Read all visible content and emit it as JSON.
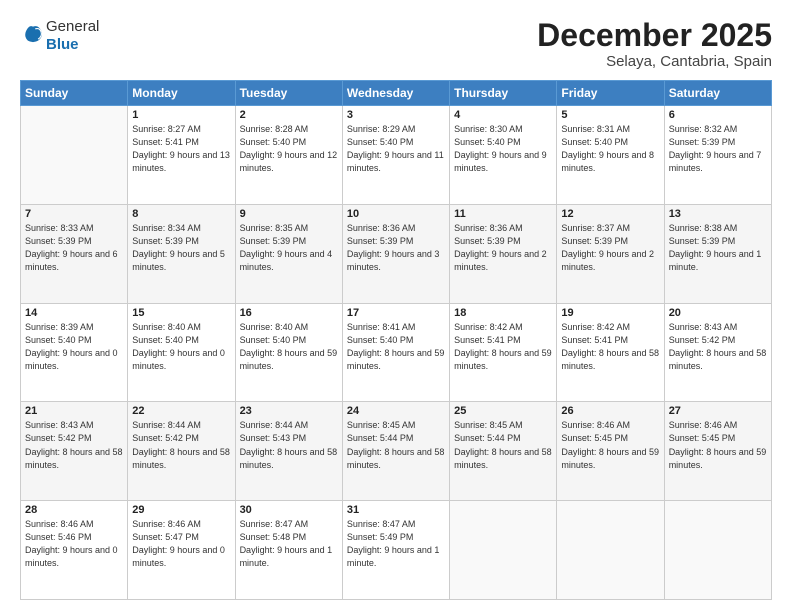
{
  "logo": {
    "general": "General",
    "blue": "Blue"
  },
  "header": {
    "month": "December 2025",
    "location": "Selaya, Cantabria, Spain"
  },
  "days_of_week": [
    "Sunday",
    "Monday",
    "Tuesday",
    "Wednesday",
    "Thursday",
    "Friday",
    "Saturday"
  ],
  "weeks": [
    [
      {
        "day": "",
        "sunrise": "",
        "sunset": "",
        "daylight": ""
      },
      {
        "day": "1",
        "sunrise": "Sunrise: 8:27 AM",
        "sunset": "Sunset: 5:41 PM",
        "daylight": "Daylight: 9 hours and 13 minutes."
      },
      {
        "day": "2",
        "sunrise": "Sunrise: 8:28 AM",
        "sunset": "Sunset: 5:40 PM",
        "daylight": "Daylight: 9 hours and 12 minutes."
      },
      {
        "day": "3",
        "sunrise": "Sunrise: 8:29 AM",
        "sunset": "Sunset: 5:40 PM",
        "daylight": "Daylight: 9 hours and 11 minutes."
      },
      {
        "day": "4",
        "sunrise": "Sunrise: 8:30 AM",
        "sunset": "Sunset: 5:40 PM",
        "daylight": "Daylight: 9 hours and 9 minutes."
      },
      {
        "day": "5",
        "sunrise": "Sunrise: 8:31 AM",
        "sunset": "Sunset: 5:40 PM",
        "daylight": "Daylight: 9 hours and 8 minutes."
      },
      {
        "day": "6",
        "sunrise": "Sunrise: 8:32 AM",
        "sunset": "Sunset: 5:39 PM",
        "daylight": "Daylight: 9 hours and 7 minutes."
      }
    ],
    [
      {
        "day": "7",
        "sunrise": "Sunrise: 8:33 AM",
        "sunset": "Sunset: 5:39 PM",
        "daylight": "Daylight: 9 hours and 6 minutes."
      },
      {
        "day": "8",
        "sunrise": "Sunrise: 8:34 AM",
        "sunset": "Sunset: 5:39 PM",
        "daylight": "Daylight: 9 hours and 5 minutes."
      },
      {
        "day": "9",
        "sunrise": "Sunrise: 8:35 AM",
        "sunset": "Sunset: 5:39 PM",
        "daylight": "Daylight: 9 hours and 4 minutes."
      },
      {
        "day": "10",
        "sunrise": "Sunrise: 8:36 AM",
        "sunset": "Sunset: 5:39 PM",
        "daylight": "Daylight: 9 hours and 3 minutes."
      },
      {
        "day": "11",
        "sunrise": "Sunrise: 8:36 AM",
        "sunset": "Sunset: 5:39 PM",
        "daylight": "Daylight: 9 hours and 2 minutes."
      },
      {
        "day": "12",
        "sunrise": "Sunrise: 8:37 AM",
        "sunset": "Sunset: 5:39 PM",
        "daylight": "Daylight: 9 hours and 2 minutes."
      },
      {
        "day": "13",
        "sunrise": "Sunrise: 8:38 AM",
        "sunset": "Sunset: 5:39 PM",
        "daylight": "Daylight: 9 hours and 1 minute."
      }
    ],
    [
      {
        "day": "14",
        "sunrise": "Sunrise: 8:39 AM",
        "sunset": "Sunset: 5:40 PM",
        "daylight": "Daylight: 9 hours and 0 minutes."
      },
      {
        "day": "15",
        "sunrise": "Sunrise: 8:40 AM",
        "sunset": "Sunset: 5:40 PM",
        "daylight": "Daylight: 9 hours and 0 minutes."
      },
      {
        "day": "16",
        "sunrise": "Sunrise: 8:40 AM",
        "sunset": "Sunset: 5:40 PM",
        "daylight": "Daylight: 8 hours and 59 minutes."
      },
      {
        "day": "17",
        "sunrise": "Sunrise: 8:41 AM",
        "sunset": "Sunset: 5:40 PM",
        "daylight": "Daylight: 8 hours and 59 minutes."
      },
      {
        "day": "18",
        "sunrise": "Sunrise: 8:42 AM",
        "sunset": "Sunset: 5:41 PM",
        "daylight": "Daylight: 8 hours and 59 minutes."
      },
      {
        "day": "19",
        "sunrise": "Sunrise: 8:42 AM",
        "sunset": "Sunset: 5:41 PM",
        "daylight": "Daylight: 8 hours and 58 minutes."
      },
      {
        "day": "20",
        "sunrise": "Sunrise: 8:43 AM",
        "sunset": "Sunset: 5:42 PM",
        "daylight": "Daylight: 8 hours and 58 minutes."
      }
    ],
    [
      {
        "day": "21",
        "sunrise": "Sunrise: 8:43 AM",
        "sunset": "Sunset: 5:42 PM",
        "daylight": "Daylight: 8 hours and 58 minutes."
      },
      {
        "day": "22",
        "sunrise": "Sunrise: 8:44 AM",
        "sunset": "Sunset: 5:42 PM",
        "daylight": "Daylight: 8 hours and 58 minutes."
      },
      {
        "day": "23",
        "sunrise": "Sunrise: 8:44 AM",
        "sunset": "Sunset: 5:43 PM",
        "daylight": "Daylight: 8 hours and 58 minutes."
      },
      {
        "day": "24",
        "sunrise": "Sunrise: 8:45 AM",
        "sunset": "Sunset: 5:44 PM",
        "daylight": "Daylight: 8 hours and 58 minutes."
      },
      {
        "day": "25",
        "sunrise": "Sunrise: 8:45 AM",
        "sunset": "Sunset: 5:44 PM",
        "daylight": "Daylight: 8 hours and 58 minutes."
      },
      {
        "day": "26",
        "sunrise": "Sunrise: 8:46 AM",
        "sunset": "Sunset: 5:45 PM",
        "daylight": "Daylight: 8 hours and 59 minutes."
      },
      {
        "day": "27",
        "sunrise": "Sunrise: 8:46 AM",
        "sunset": "Sunset: 5:45 PM",
        "daylight": "Daylight: 8 hours and 59 minutes."
      }
    ],
    [
      {
        "day": "28",
        "sunrise": "Sunrise: 8:46 AM",
        "sunset": "Sunset: 5:46 PM",
        "daylight": "Daylight: 9 hours and 0 minutes."
      },
      {
        "day": "29",
        "sunrise": "Sunrise: 8:46 AM",
        "sunset": "Sunset: 5:47 PM",
        "daylight": "Daylight: 9 hours and 0 minutes."
      },
      {
        "day": "30",
        "sunrise": "Sunrise: 8:47 AM",
        "sunset": "Sunset: 5:48 PM",
        "daylight": "Daylight: 9 hours and 1 minute."
      },
      {
        "day": "31",
        "sunrise": "Sunrise: 8:47 AM",
        "sunset": "Sunset: 5:49 PM",
        "daylight": "Daylight: 9 hours and 1 minute."
      },
      {
        "day": "",
        "sunrise": "",
        "sunset": "",
        "daylight": ""
      },
      {
        "day": "",
        "sunrise": "",
        "sunset": "",
        "daylight": ""
      },
      {
        "day": "",
        "sunrise": "",
        "sunset": "",
        "daylight": ""
      }
    ]
  ]
}
